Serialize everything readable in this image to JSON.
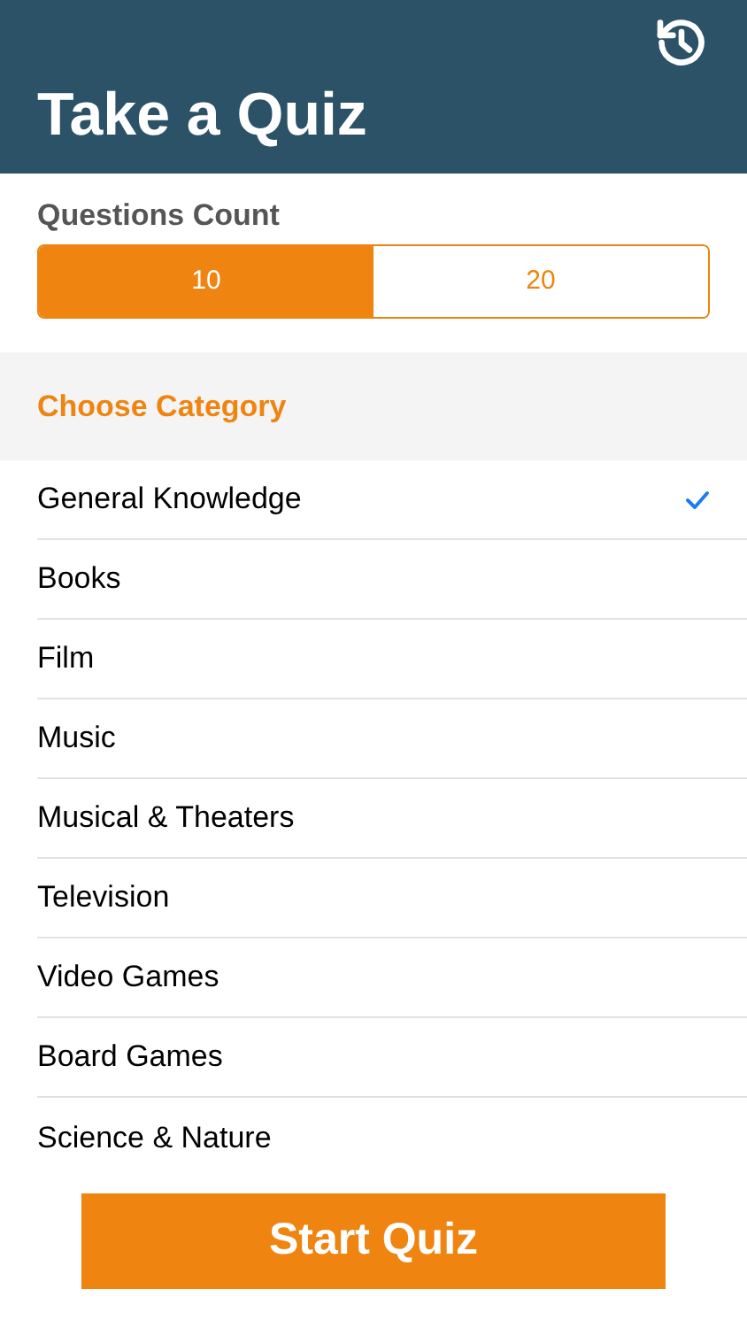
{
  "header": {
    "title": "Take a Quiz"
  },
  "questions_count": {
    "label": "Questions Count",
    "options": [
      {
        "label": "10",
        "selected": true
      },
      {
        "label": "20",
        "selected": false
      }
    ]
  },
  "category": {
    "heading": "Choose Category",
    "items": [
      {
        "label": "General Knowledge",
        "selected": true
      },
      {
        "label": "Books",
        "selected": false
      },
      {
        "label": "Film",
        "selected": false
      },
      {
        "label": "Music",
        "selected": false
      },
      {
        "label": "Musical & Theaters",
        "selected": false
      },
      {
        "label": "Television",
        "selected": false
      },
      {
        "label": "Video Games",
        "selected": false
      },
      {
        "label": "Board Games",
        "selected": false
      },
      {
        "label": "Science & Nature",
        "selected": false
      }
    ]
  },
  "start_button": {
    "label": "Start Quiz"
  }
}
